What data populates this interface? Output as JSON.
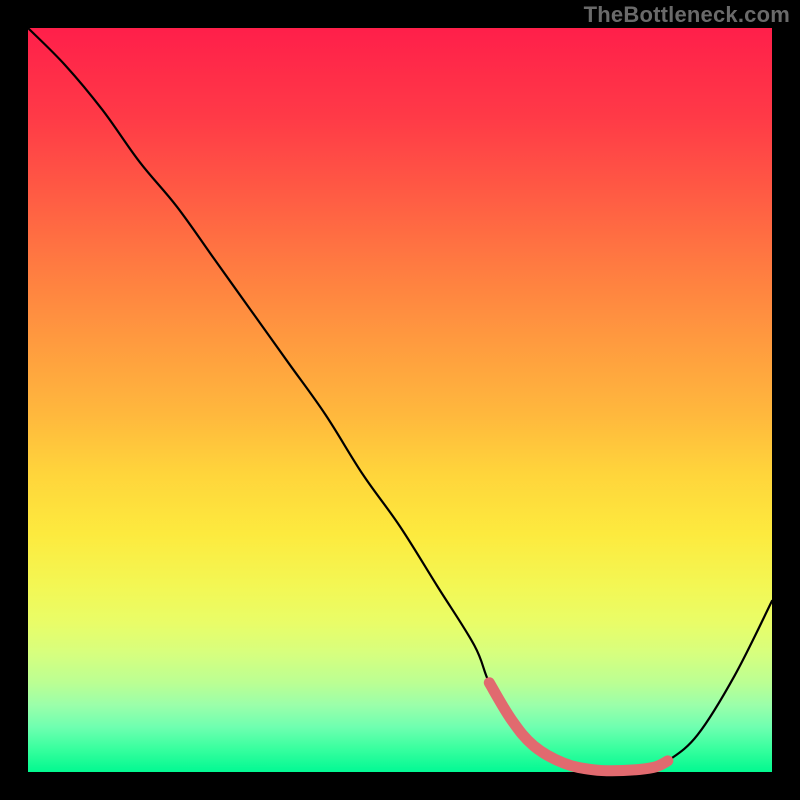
{
  "watermark": "TheBottleneck.com",
  "chart_data": {
    "type": "line",
    "title": "",
    "xlabel": "",
    "ylabel": "",
    "xlim": [
      0,
      100
    ],
    "ylim": [
      0,
      100
    ],
    "x": [
      0,
      5,
      10,
      15,
      20,
      25,
      30,
      35,
      40,
      45,
      50,
      55,
      60,
      62,
      65,
      68,
      72,
      76,
      80,
      84,
      86,
      90,
      95,
      100
    ],
    "values": [
      100,
      95,
      89,
      82,
      76,
      69,
      62,
      55,
      48,
      40,
      33,
      25,
      17,
      12,
      7,
      3.5,
      1.2,
      0.3,
      0.2,
      0.6,
      1.5,
      5,
      13,
      23
    ],
    "marker_region": {
      "x": [
        62,
        65,
        68,
        72,
        76,
        80,
        84,
        86
      ],
      "y": [
        12,
        7,
        3.5,
        1.2,
        0.3,
        0.2,
        0.6,
        1.5
      ],
      "color": "#e16a6f"
    },
    "background_gradient": {
      "top": "#ff1f4a",
      "bottom": "#02f77e"
    },
    "curve_color": "#000000"
  }
}
